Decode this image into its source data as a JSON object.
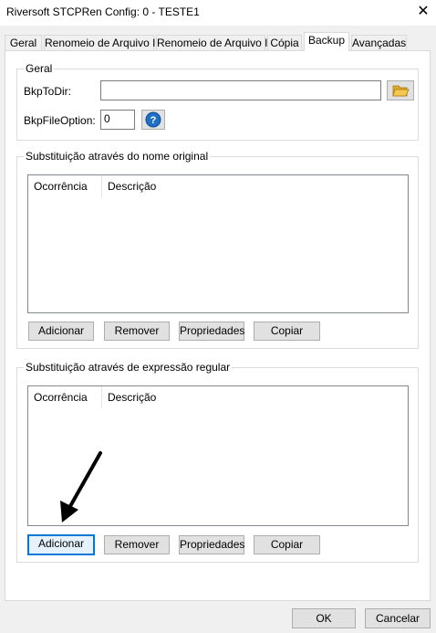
{
  "window": {
    "title": "Riversoft STCPRen Config: 0 - TESTE1",
    "close_glyph": "✕"
  },
  "tabs": [
    {
      "label": "Geral"
    },
    {
      "label": "Renomeio de Arquivo I"
    },
    {
      "label": "Renomeio de Arquivo II"
    },
    {
      "label": "Cópia"
    },
    {
      "label": "Backup",
      "active": true
    },
    {
      "label": "Avançadas"
    }
  ],
  "geral": {
    "legend": "Geral",
    "bkp_to_dir_label": "BkpToDir:",
    "bkp_to_dir_value": "",
    "bkp_file_option_label": "BkpFileOption:",
    "bkp_file_option_value": "0",
    "browse_icon": "folder-open-icon",
    "help_icon": "help-question-icon",
    "help_glyph": "?"
  },
  "nome_original": {
    "legend": "Substituição através do nome original",
    "columns": [
      "Ocorrência",
      "Descrição"
    ],
    "rows": [],
    "buttons": {
      "add": "Adicionar",
      "remove": "Remover",
      "props": "Propriedades",
      "copy": "Copiar"
    }
  },
  "expressao_regular": {
    "legend": "Substituição através de expressão regular",
    "columns": [
      "Ocorrência",
      "Descrição"
    ],
    "rows": [],
    "buttons": {
      "add": "Adicionar",
      "remove": "Remover",
      "props": "Propriedades",
      "copy": "Copiar"
    }
  },
  "footer": {
    "ok": "OK",
    "cancel": "Cancelar"
  },
  "colors": {
    "focus_border": "#0078d7",
    "help_blue": "#1f6fc6",
    "folder_yellow": "#f2c94c"
  }
}
